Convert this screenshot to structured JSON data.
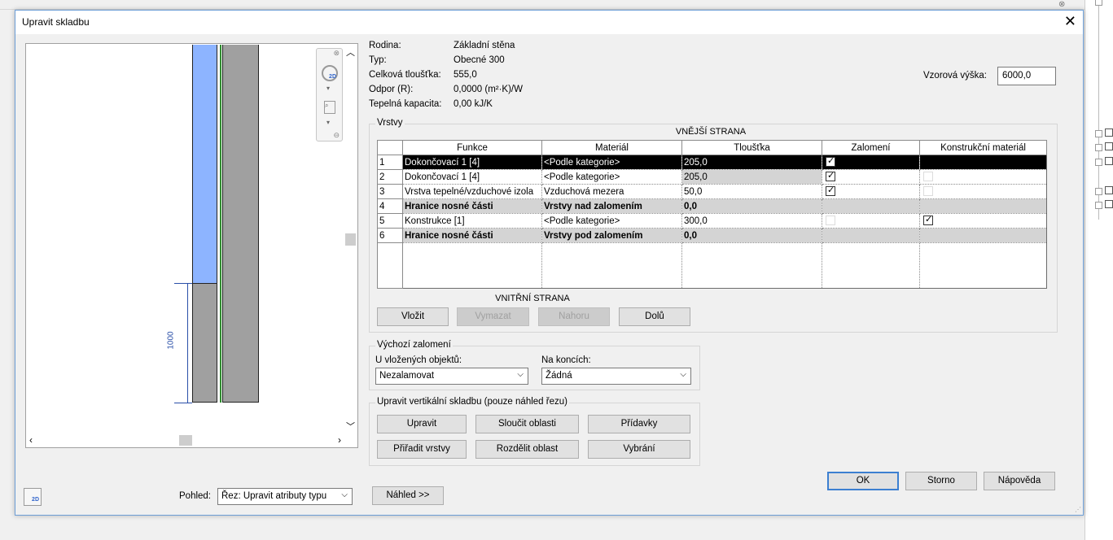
{
  "dialog": {
    "title": "Upravit skladbu"
  },
  "props": {
    "rodina_label": "Rodina:",
    "rodina_value": "Základní stěna",
    "typ_label": "Typ:",
    "typ_value": "Obecné 300",
    "tloustka_label": "Celková tloušťka:",
    "tloustka_value": "555,0",
    "odpor_label": "Odpor (R):",
    "odpor_value": "0,0000 (m²·K)/W",
    "kapacita_label": "Tepelná kapacita:",
    "kapacita_value": "0,00 kJ/K",
    "sample_label": "Vzorová výška:",
    "sample_value": "6000,0"
  },
  "preview": {
    "dimension": "1000"
  },
  "layers": {
    "group_title": "Vrstvy",
    "exterior_label": "VNĚJŠÍ STRANA",
    "interior_label": "VNITŘNÍ STRANA",
    "headers": [
      "Funkce",
      "Materiál",
      "Tloušťka",
      "Zalomení",
      "Konstrukční materiál"
    ],
    "rows": [
      {
        "num": "1",
        "funkce": "Dokončovací 1 [4]",
        "material": "<Podle kategorie>",
        "tloustka": "205,0"
      },
      {
        "num": "2",
        "funkce": "Dokončovací 1 [4]",
        "material": "<Podle kategorie>",
        "tloustka": "205,0"
      },
      {
        "num": "3",
        "funkce": "Vrstva tepelné/vzduchové izola",
        "material": "Vzduchová mezera",
        "tloustka": "50,0"
      },
      {
        "num": "4",
        "funkce": "Hranice nosné části",
        "material": "Vrstvy nad zalomením",
        "tloustka": "0,0"
      },
      {
        "num": "5",
        "funkce": "Konstrukce [1]",
        "material": "<Podle kategorie>",
        "tloustka": "300,0"
      },
      {
        "num": "6",
        "funkce": "Hranice nosné části",
        "material": "Vrstvy pod zalomením",
        "tloustka": "0,0"
      }
    ],
    "buttons": {
      "insert": "Vložit",
      "delete": "Vymazat",
      "up": "Nahoru",
      "down": "Dolů"
    }
  },
  "wrapping": {
    "group_title": "Výchozí zalomení",
    "inserts_label": "U vložených objektů:",
    "inserts_value": "Nezalamovat",
    "ends_label": "Na koncích:",
    "ends_value": "Žádná"
  },
  "vertical": {
    "group_title": "Upravit vertikální skladbu (pouze náhled řezu)",
    "buttons": {
      "modify": "Upravit",
      "merge": "Sloučit oblasti",
      "sweeps": "Přídavky",
      "assign": "Přiřadit vrstvy",
      "split": "Rozdělit oblast",
      "reveals": "Vybrání"
    }
  },
  "footer": {
    "view_label": "Pohled:",
    "view_value": "Řez: Upravit atributy typu",
    "preview_button": "Náhled >>",
    "ok": "OK",
    "cancel": "Storno",
    "help": "Nápověda"
  }
}
